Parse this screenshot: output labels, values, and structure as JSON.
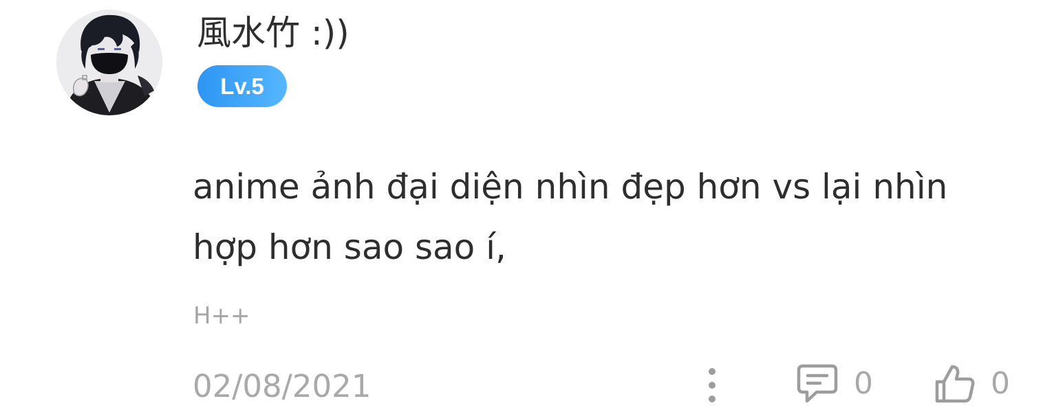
{
  "comment": {
    "username": "風水竹 :))",
    "level_badge": "Lv.5",
    "text": "anime ảnh đại diện nhìn đẹp hơn vs lại nhìn hợp hơn sao sao í,",
    "sub_text": "H++",
    "date": "02/08/2021",
    "reply_count": "0",
    "like_count": "0",
    "avatar_icon": "user-avatar-masked-figure",
    "more_icon": "vertical-dots-icon",
    "reply_icon": "comment-bubble-icon",
    "like_icon": "thumbs-up-icon"
  },
  "colors": {
    "badge_start": "#2d95f3",
    "badge_end": "#56b7ff",
    "text": "#2e2e2e",
    "muted": "#a9a9a9"
  }
}
